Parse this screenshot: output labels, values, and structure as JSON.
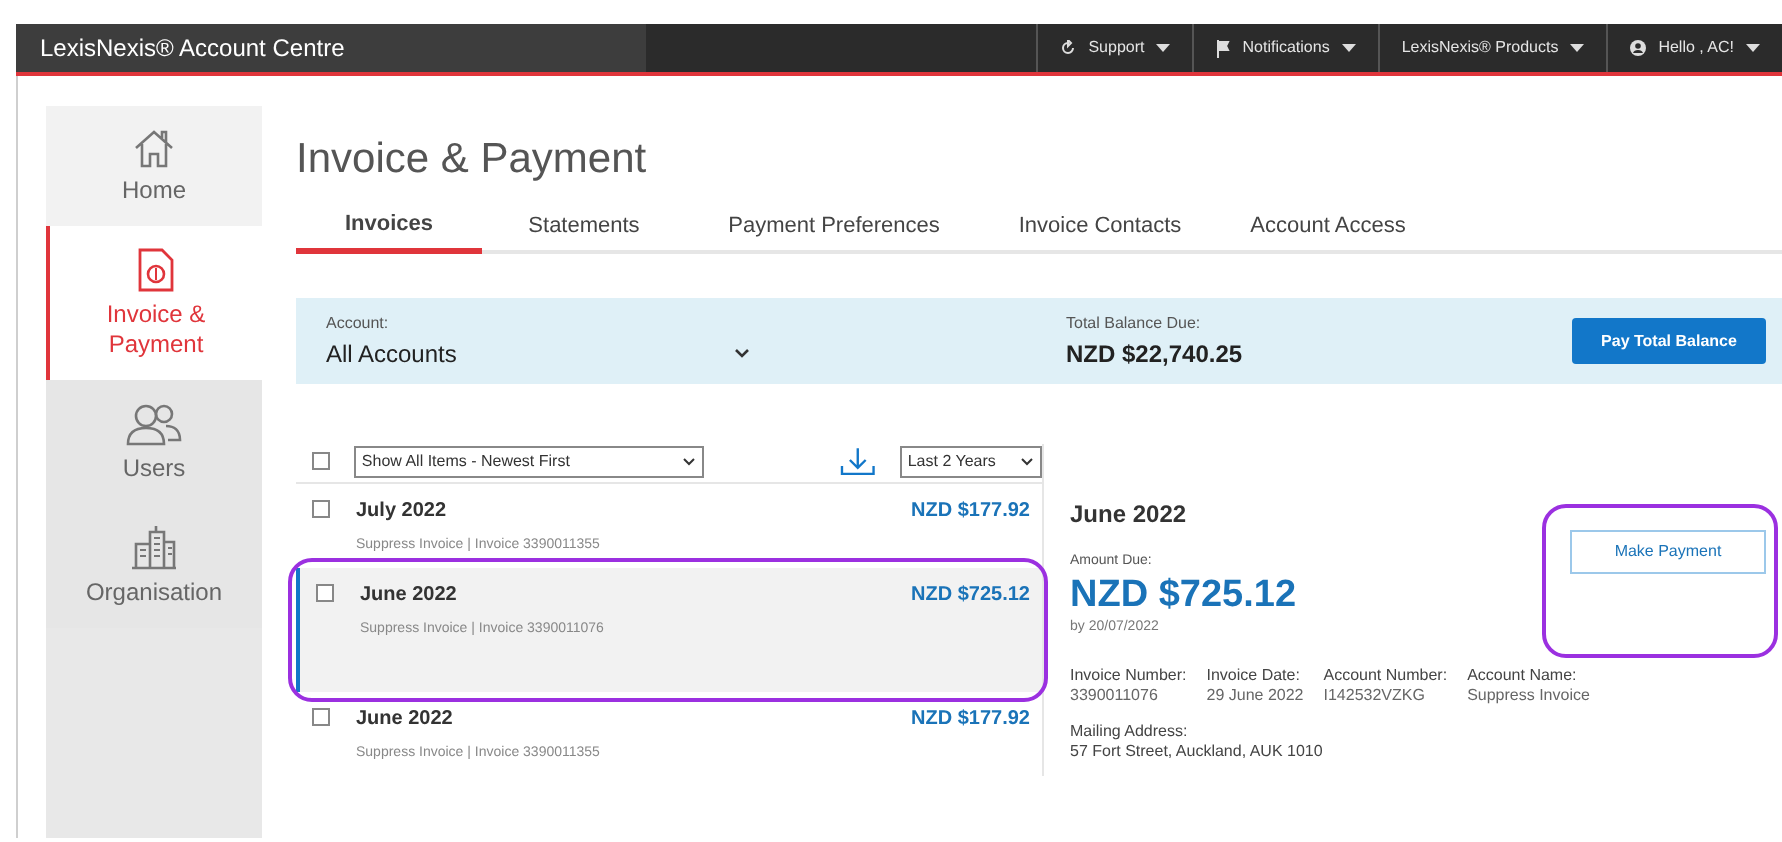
{
  "header": {
    "title": "LexisNexis® Account Centre",
    "menus": [
      {
        "label": "Support",
        "kind": "support"
      },
      {
        "label": "Notifications",
        "kind": "notifications"
      },
      {
        "label": "LexisNexis® Products",
        "kind": "products"
      },
      {
        "label": "Hello , AC!",
        "kind": "account"
      }
    ]
  },
  "sidebar": {
    "items": [
      {
        "label": "Home",
        "kind": "home",
        "selected": false
      },
      {
        "label": "Invoice & Payment",
        "kind": "invoice",
        "selected": true
      },
      {
        "label": "Users",
        "kind": "users",
        "selected": false
      },
      {
        "label": "Organisation",
        "kind": "organisation",
        "selected": false
      }
    ]
  },
  "page_title": "Invoice & Payment",
  "tabs": [
    {
      "label": "Invoices",
      "selected": true
    },
    {
      "label": "Statements",
      "selected": false
    },
    {
      "label": "Payment Preferences",
      "selected": false
    },
    {
      "label": "Invoice Contacts",
      "selected": false
    },
    {
      "label": "Account Access",
      "selected": false
    }
  ],
  "account_bar": {
    "account_label": "Account:",
    "account_value": "All Accounts",
    "balance_label": "Total Balance Due:",
    "balance_value": "NZD $22,740.25",
    "button": "Pay Total Balance"
  },
  "filters": {
    "select_all_checked": false,
    "sort": "Show All Items - Newest First",
    "period": "Last 2 Years"
  },
  "invoices": [
    {
      "month": "July 2022",
      "amount": "NZD $177.92",
      "detail": "Suppress Invoice | Invoice 3390011355",
      "checked": false,
      "selected": false,
      "highlighted": false
    },
    {
      "month": "June 2022",
      "amount": "NZD $725.12",
      "detail": "Suppress Invoice | Invoice 3390011076",
      "checked": false,
      "selected": true,
      "highlighted": true
    },
    {
      "month": "June 2022",
      "amount": "NZD $177.92",
      "detail": "Suppress Invoice | Invoice 3390011355",
      "checked": false,
      "selected": false,
      "highlighted": false
    }
  ],
  "detail": {
    "title": "June 2022",
    "amount_label": "Amount Due:",
    "amount": "NZD $725.12",
    "due": "by 20/07/2022",
    "button": "Make Payment",
    "button_highlighted": true,
    "fields": [
      {
        "label": "Invoice Number:",
        "value": "3390011076"
      },
      {
        "label": "Invoice Date:",
        "value": "29 June 2022"
      },
      {
        "label": "Account Number:",
        "value": "I142532VZKG"
      },
      {
        "label": "Account Name:",
        "value": "Suppress Invoice"
      }
    ],
    "address_label": "Mailing Address:",
    "address": "57 Fort Street, Auckland, AUK 1010"
  }
}
